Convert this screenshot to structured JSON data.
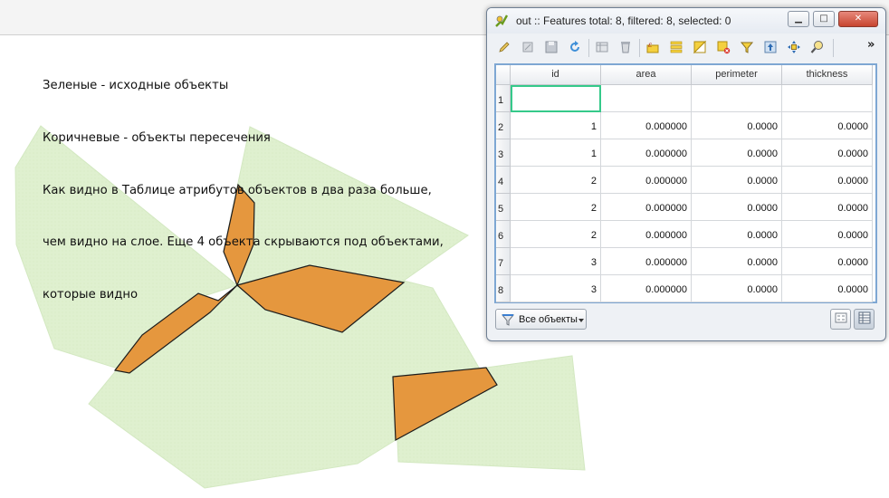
{
  "notes": {
    "lines": [
      "Зеленые - исходные объекты",
      "Коричневые - объекты пересечения",
      "Как видно в Таблице атрибутов объектов в два раза больше,",
      "чем видно на слое. Еще 4 объекта скрываются под объектами,",
      "которые видно"
    ]
  },
  "colors": {
    "source_fill": "#dff0cf",
    "intersection_fill": "#e5973e",
    "selection_border": "#35c98a",
    "table_border": "#7ea7d3"
  },
  "window": {
    "title": "out :: Features total: 8, filtered: 8, selected: 0",
    "icon": "qgis-icon",
    "controls": [
      "minimize-icon",
      "maximize-icon",
      "close-icon"
    ]
  },
  "toolbar": {
    "icons": [
      "pencil-edit-icon",
      "toggle-multiedit-icon",
      "save-edits-icon",
      "reload-icon",
      "add-feature-icon",
      "delete-feature-icon",
      "expression-select-icon",
      "select-all-icon",
      "invert-selection-icon",
      "deselect-all-icon",
      "filter-select-icon",
      "move-selection-top-icon",
      "pan-to-selection-icon",
      "zoom-to-selection-icon"
    ],
    "more": "»"
  },
  "table": {
    "columns": [
      "id",
      "area",
      "perimeter",
      "thickness"
    ],
    "rows": [
      {
        "n": "1",
        "cells": [
          "",
          "",
          "",
          ""
        ]
      },
      {
        "n": "2",
        "cells": [
          "1",
          "0.000000",
          "0.0000",
          "0.0000"
        ]
      },
      {
        "n": "3",
        "cells": [
          "1",
          "0.000000",
          "0.0000",
          "0.0000"
        ]
      },
      {
        "n": "4",
        "cells": [
          "2",
          "0.000000",
          "0.0000",
          "0.0000"
        ]
      },
      {
        "n": "5",
        "cells": [
          "2",
          "0.000000",
          "0.0000",
          "0.0000"
        ]
      },
      {
        "n": "6",
        "cells": [
          "2",
          "0.000000",
          "0.0000",
          "0.0000"
        ]
      },
      {
        "n": "7",
        "cells": [
          "3",
          "0.000000",
          "0.0000",
          "0.0000"
        ]
      },
      {
        "n": "8",
        "cells": [
          "3",
          "0.000000",
          "0.0000",
          "0.0000"
        ]
      }
    ]
  },
  "footer": {
    "filter_label": "Все объекты",
    "filter_icon": "filter-funnel-icon",
    "views": [
      "form-view-icon",
      "table-view-icon"
    ]
  }
}
